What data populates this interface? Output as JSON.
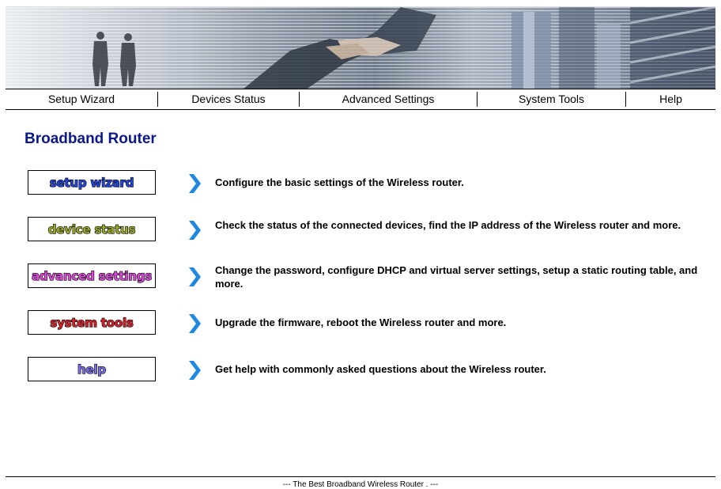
{
  "nav": {
    "items": [
      {
        "label": "Setup Wizard"
      },
      {
        "label": "Devices Status"
      },
      {
        "label": "Advanced Settings"
      },
      {
        "label": "System Tools"
      },
      {
        "label": "Help"
      }
    ]
  },
  "page": {
    "title": "Broadband Router"
  },
  "rows": [
    {
      "button_label": "setup wizard",
      "button_color": "#2446d8",
      "description": "Configure the basic settings of the Wireless router."
    },
    {
      "button_label": "device status",
      "button_color": "#9aa82a",
      "description": "Check the status of the connected devices, find the IP address of the Wireless router and more."
    },
    {
      "button_label": "advanced settings",
      "button_color": "#d84ad6",
      "description": "Change the password, configure DHCP and virtual server settings, setup a static routing table, and more."
    },
    {
      "button_label": "system tools",
      "button_color": "#d8202a",
      "description": "Upgrade the firmware, reboot the Wireless router and more."
    },
    {
      "button_label": "help",
      "button_color": "#7a70e8",
      "description": "Get help with commonly asked questions about the Wireless router."
    }
  ],
  "footer": {
    "text": "--- The Best Broadband Wireless Router . ---"
  },
  "colors": {
    "title": "#0a188c",
    "arrow": "#1e88e0"
  },
  "icons": {
    "banner": "business-handshake-banner",
    "arrow": "chevron-right-icon"
  }
}
